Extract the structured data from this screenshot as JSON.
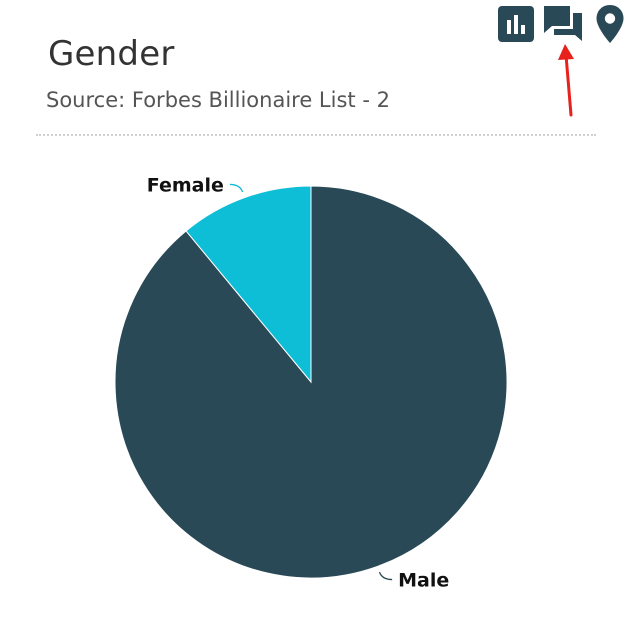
{
  "header": {
    "title": "Gender",
    "source": "Source: Forbes Billionaire List - 2"
  },
  "toolbar": {
    "items": [
      {
        "icon": "bar-chart-icon"
      },
      {
        "icon": "comments-icon"
      },
      {
        "icon": "location-pin-icon"
      }
    ]
  },
  "chart_data": {
    "type": "pie",
    "title": "Gender",
    "start_angle_deg": 0,
    "direction": "clockwise",
    "legend": "none",
    "slices": [
      {
        "label": "Male",
        "value": 89,
        "color": "#284955"
      },
      {
        "label": "Female",
        "value": 11,
        "color": "#0ebed6"
      }
    ]
  },
  "colors": {
    "icon": "#284955",
    "divider": "#d0d0d0",
    "annotation_arrow": "#e8211c"
  }
}
